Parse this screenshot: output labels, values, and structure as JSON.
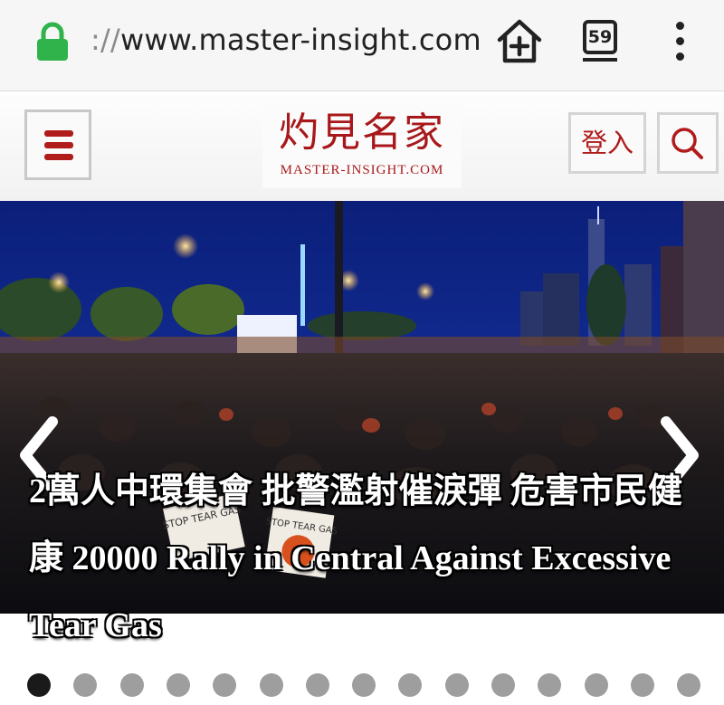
{
  "browser": {
    "url_protocol": "://",
    "url_host": "www.master-insight.com",
    "tab_count": "59",
    "lock_icon": "lock-icon",
    "home_icon": "home-plus-icon",
    "menu_icon": "more-vert-icon"
  },
  "header": {
    "menu_icon": "hamburger-icon",
    "logo_cn": "灼見名家",
    "logo_en": "MASTER-INSIGHT.COM",
    "login_label": "登入",
    "search_icon": "search-icon",
    "brand_color": "#b01b1b"
  },
  "slider": {
    "caption": "2萬人中環集會 批警濫射催淚彈 危害市民健康 20000 Rally in Central Against Excessive Tear Gas",
    "prev_icon": "chevron-left-icon",
    "next_icon": "chevron-right-icon",
    "image_sign_1": "STOP TEAR GAS",
    "image_sign_2": "STOP TEAR GAS",
    "dots_total": 15,
    "active_index": 0
  }
}
